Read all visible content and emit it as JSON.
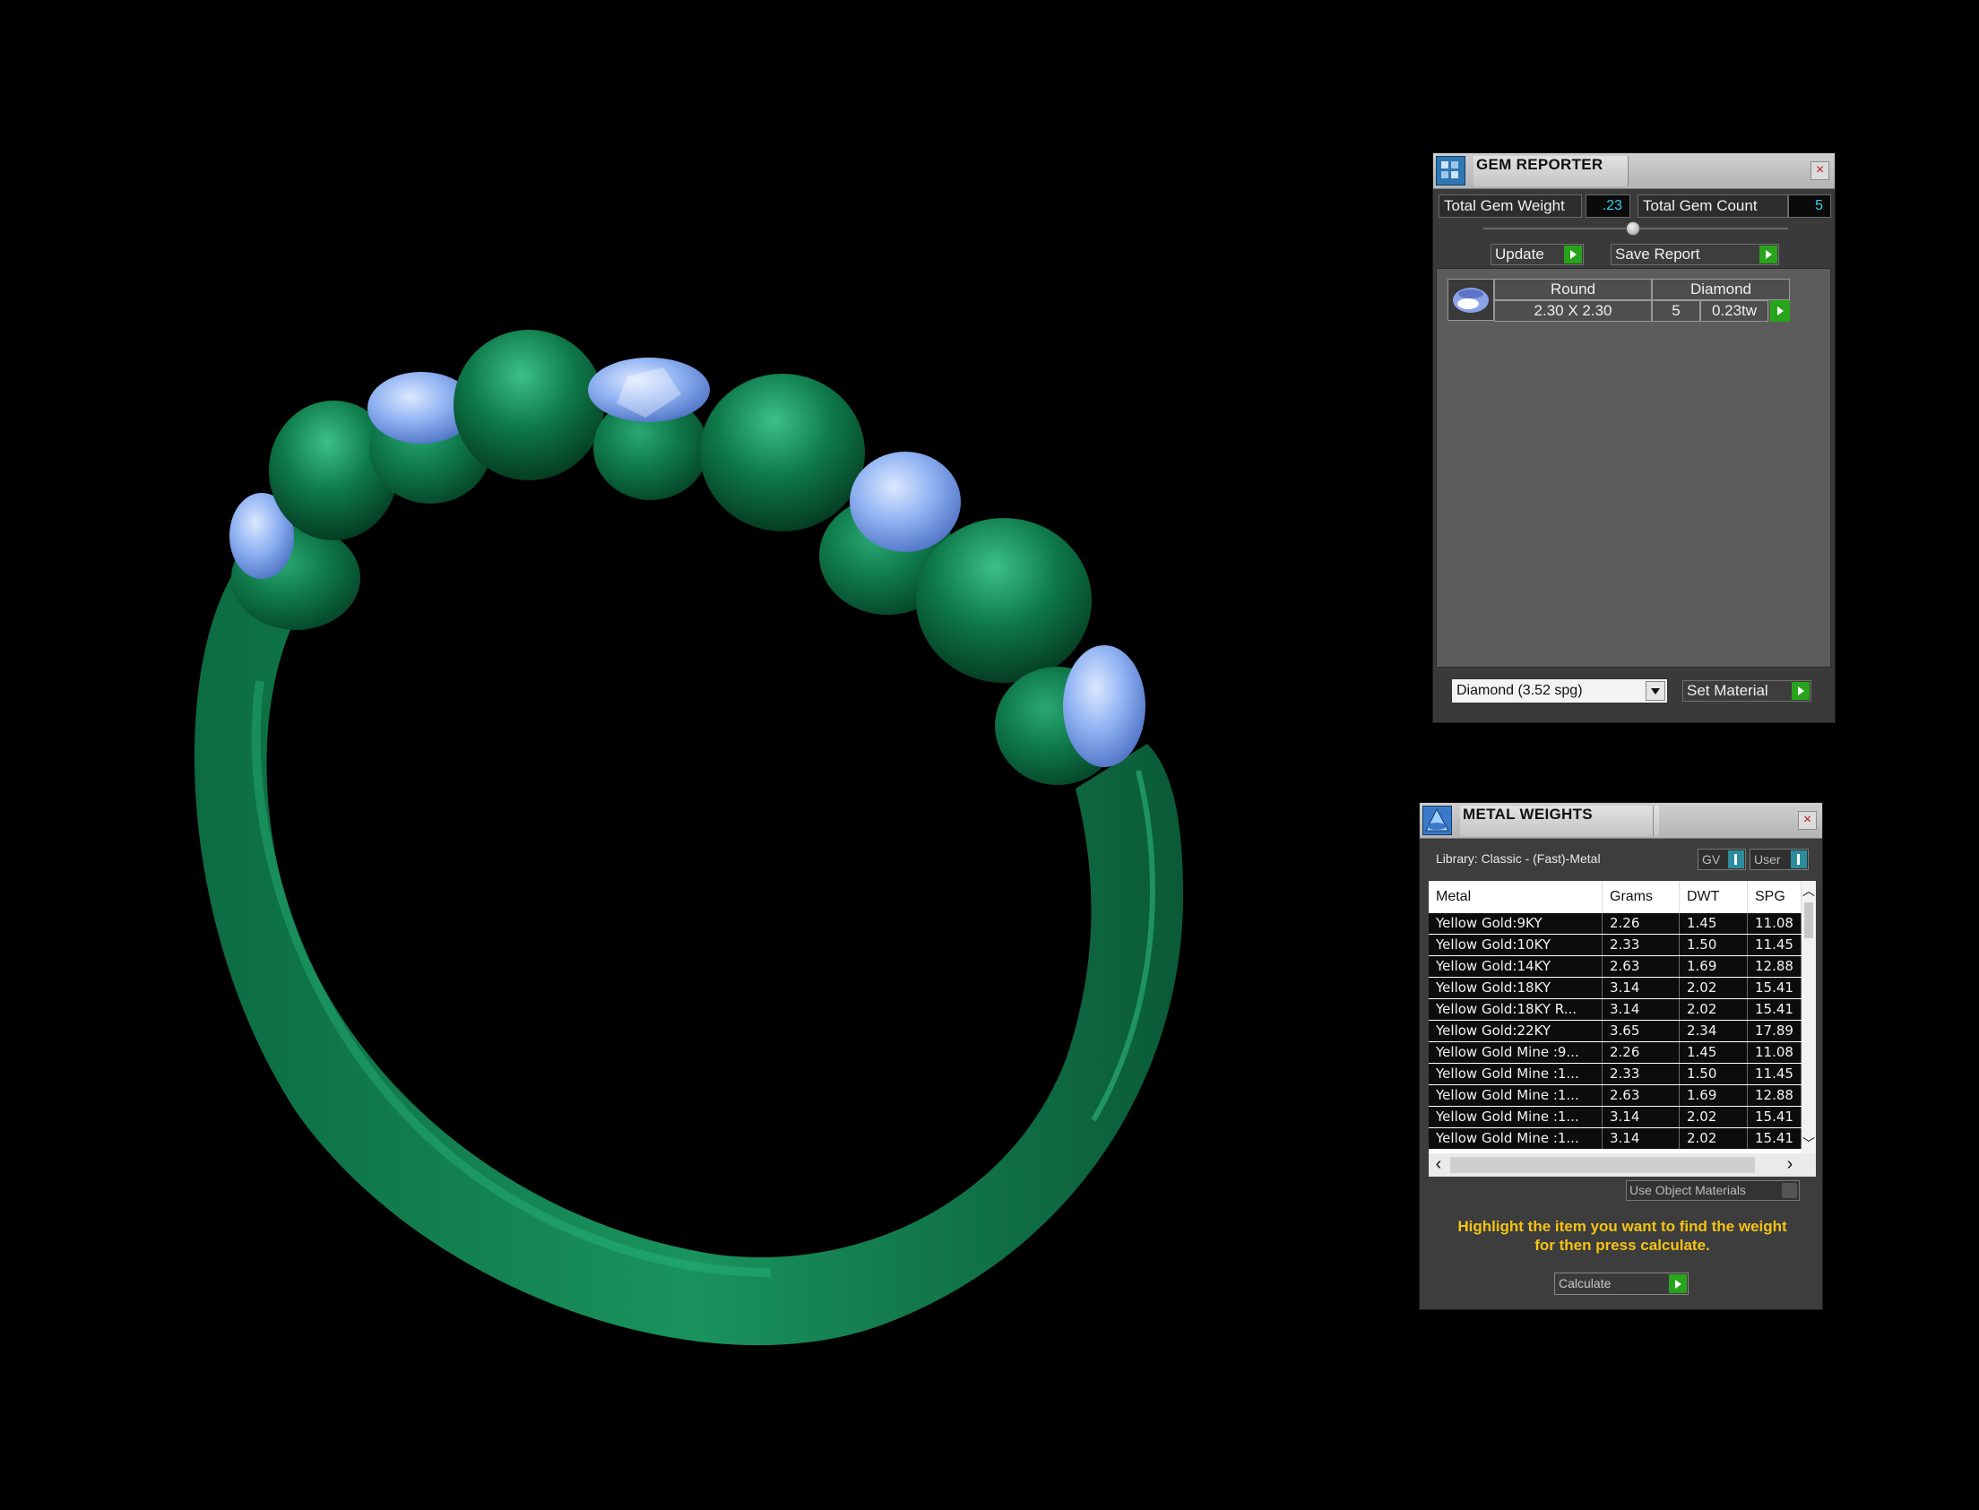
{
  "gem_reporter": {
    "title": "GEM REPORTER",
    "close_label": "×",
    "total_weight_label": "Total Gem Weight",
    "total_weight_value": ".23",
    "total_count_label": "Total Gem Count",
    "total_count_value": "5",
    "update_label": "Update",
    "save_report_label": "Save Report",
    "gems": [
      {
        "shape": "Round",
        "material": "Diamond",
        "size": "2.30 X 2.30",
        "count": "5",
        "weight": "0.23tw"
      }
    ],
    "material_select": "Diamond    (3.52 spg)",
    "set_material_label": "Set Material"
  },
  "metal_weights": {
    "title": "METAL WEIGHTS",
    "close_label": "×",
    "library_label": "Library: Classic - (Fast)-Metal",
    "toggle_gv": "GV",
    "toggle_user": "User",
    "columns": [
      "Metal",
      "Grams",
      "DWT",
      "SPG"
    ],
    "rows": [
      [
        "Yellow Gold:9KY",
        "2.26",
        "1.45",
        "11.08"
      ],
      [
        "Yellow Gold:10KY",
        "2.33",
        "1.50",
        "11.45"
      ],
      [
        "Yellow Gold:14KY",
        "2.63",
        "1.69",
        "12.88"
      ],
      [
        "Yellow Gold:18KY",
        "3.14",
        "2.02",
        "15.41"
      ],
      [
        "Yellow Gold:18KY R...",
        "3.14",
        "2.02",
        "15.41"
      ],
      [
        "Yellow Gold:22KY",
        "3.65",
        "2.34",
        "17.89"
      ],
      [
        "Yellow Gold Mine :9...",
        "2.26",
        "1.45",
        "11.08"
      ],
      [
        "Yellow Gold Mine :1...",
        "2.33",
        "1.50",
        "11.45"
      ],
      [
        "Yellow Gold Mine :1...",
        "2.63",
        "1.69",
        "12.88"
      ],
      [
        "Yellow Gold Mine :1...",
        "3.14",
        "2.02",
        "15.41"
      ],
      [
        "Yellow Gold Mine :1...",
        "3.14",
        "2.02",
        "15.41"
      ]
    ],
    "use_object_materials_label": "Use Object Materials",
    "hint_line1": "Highlight the item you want to find the weight",
    "hint_line2": "for then press calculate.",
    "calculate_label": "Calculate"
  },
  "colors": {
    "ring_metal": "#0f7a4c",
    "gem_blue": "#8fb2f2",
    "accent_green": "#27a41b",
    "value_cyan": "#39d0ea",
    "hint_yellow": "#f5c312"
  }
}
